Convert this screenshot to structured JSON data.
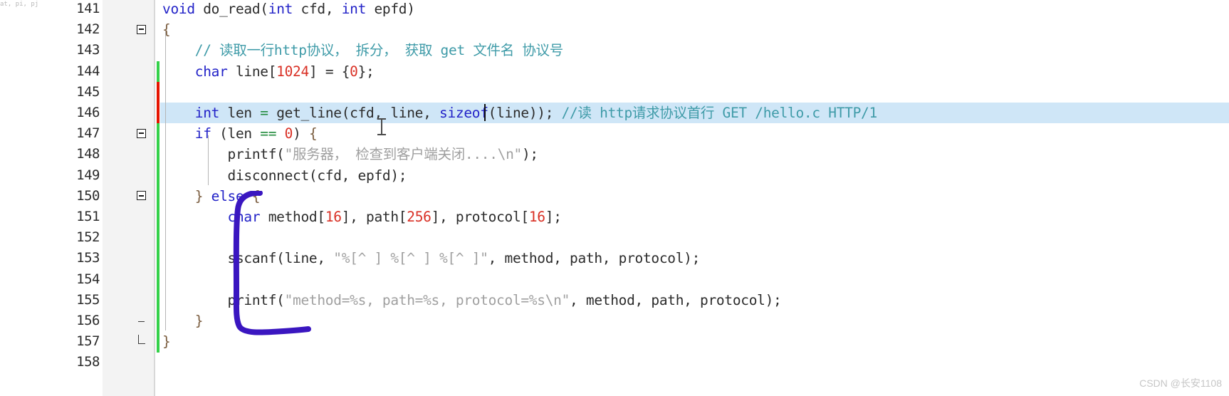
{
  "app": {
    "kind": "code-editor",
    "language": "C",
    "top_partial_text": "at, pi, pj"
  },
  "colors": {
    "keyword": "#2323c8",
    "comment": "#3f9ba8",
    "string": "#a0a0a0",
    "number": "#d93025",
    "operator": "#1f8a3b",
    "brace": "#7a5c3e",
    "current_line_highlight": "#cfe6f7",
    "gutter_background": "#f3f3f3",
    "change_bar_saved": "#34d14a",
    "change_bar_unsaved": "#e51400",
    "annotation_ink": "#3a16c0",
    "watermark": "#c6c6c6"
  },
  "gutter": {
    "first_line": 141,
    "last_line": 158
  },
  "editor": {
    "highlighted_line": 146,
    "caret_line": 146,
    "caret_column_text": "l|ine"
  },
  "lines": [
    {
      "number": "141",
      "fold": "none",
      "change": "none",
      "indent": 0,
      "tokens": [
        {
          "t": "void ",
          "c": "kw"
        },
        {
          "t": "do_read",
          "c": "plain"
        },
        {
          "t": "(",
          "c": "plain"
        },
        {
          "t": "int ",
          "c": "kw"
        },
        {
          "t": "cfd, ",
          "c": "plain"
        },
        {
          "t": "int ",
          "c": "kw"
        },
        {
          "t": "epfd)",
          "c": "plain"
        }
      ]
    },
    {
      "number": "142",
      "fold": "open",
      "change": "none",
      "indent": 0,
      "tokens": [
        {
          "t": "{",
          "c": "brace"
        }
      ]
    },
    {
      "number": "143",
      "fold": "none",
      "change": "none",
      "indent": 1,
      "tokens": [
        {
          "t": "    // 读取一行http协议， 拆分， 获取 get 文件名 协议号",
          "c": "cmt"
        }
      ]
    },
    {
      "number": "144",
      "fold": "none",
      "change": "green",
      "indent": 1,
      "tokens": [
        {
          "t": "    ",
          "c": "plain"
        },
        {
          "t": "char ",
          "c": "kw"
        },
        {
          "t": "line[",
          "c": "plain"
        },
        {
          "t": "1024",
          "c": "num"
        },
        {
          "t": "] = {",
          "c": "plain"
        },
        {
          "t": "0",
          "c": "num"
        },
        {
          "t": "};",
          "c": "plain"
        }
      ]
    },
    {
      "number": "145",
      "fold": "none",
      "change": "red",
      "indent": 1,
      "tokens": []
    },
    {
      "number": "146",
      "fold": "none",
      "change": "red",
      "indent": 1,
      "highlight": true,
      "tokens": [
        {
          "t": "    ",
          "c": "plain"
        },
        {
          "t": "int ",
          "c": "kw"
        },
        {
          "t": "len ",
          "c": "plain"
        },
        {
          "t": "= ",
          "c": "op"
        },
        {
          "t": "get_line(cfd, line, ",
          "c": "plain"
        },
        {
          "t": "sizeof",
          "c": "kw"
        },
        {
          "t": "(line)); ",
          "c": "plain"
        },
        {
          "t": "//读 http请求协议首行 GET /hello.c HTTP/1",
          "c": "cmt"
        }
      ]
    },
    {
      "number": "147",
      "fold": "open",
      "change": "green",
      "indent": 1,
      "tokens": [
        {
          "t": "    ",
          "c": "plain"
        },
        {
          "t": "if ",
          "c": "kw"
        },
        {
          "t": "(len ",
          "c": "plain"
        },
        {
          "t": "== ",
          "c": "op"
        },
        {
          "t": "0",
          "c": "num"
        },
        {
          "t": ") ",
          "c": "plain"
        },
        {
          "t": "{",
          "c": "brace"
        }
      ]
    },
    {
      "number": "148",
      "fold": "none",
      "change": "green",
      "indent": 2,
      "tokens": [
        {
          "t": "        printf(",
          "c": "plain"
        },
        {
          "t": "\"服务器， 检查到客户端关闭....\\n\"",
          "c": "str"
        },
        {
          "t": ");",
          "c": "plain"
        }
      ]
    },
    {
      "number": "149",
      "fold": "none",
      "change": "green",
      "indent": 2,
      "tokens": [
        {
          "t": "        disconnect(cfd, epfd);",
          "c": "plain"
        }
      ]
    },
    {
      "number": "150",
      "fold": "open",
      "change": "green",
      "indent": 1,
      "tokens": [
        {
          "t": "    ",
          "c": "plain"
        },
        {
          "t": "}",
          "c": "brace"
        },
        {
          "t": " else ",
          "c": "kw"
        },
        {
          "t": "{",
          "c": "brace"
        }
      ]
    },
    {
      "number": "151",
      "fold": "none",
      "change": "green",
      "indent": 2,
      "tokens": [
        {
          "t": "        ",
          "c": "plain"
        },
        {
          "t": "char ",
          "c": "kw"
        },
        {
          "t": "method[",
          "c": "plain"
        },
        {
          "t": "16",
          "c": "num"
        },
        {
          "t": "], path[",
          "c": "plain"
        },
        {
          "t": "256",
          "c": "num"
        },
        {
          "t": "], protocol[",
          "c": "plain"
        },
        {
          "t": "16",
          "c": "num"
        },
        {
          "t": "];",
          "c": "plain"
        }
      ]
    },
    {
      "number": "152",
      "fold": "none",
      "change": "green",
      "indent": 2,
      "tokens": []
    },
    {
      "number": "153",
      "fold": "none",
      "change": "green",
      "indent": 2,
      "tokens": [
        {
          "t": "        sscanf(line, ",
          "c": "plain"
        },
        {
          "t": "\"%[^ ] %[^ ] %[^ ]\"",
          "c": "str"
        },
        {
          "t": ", method, path, protocol);",
          "c": "plain"
        }
      ]
    },
    {
      "number": "154",
      "fold": "none",
      "change": "green",
      "indent": 2,
      "tokens": []
    },
    {
      "number": "155",
      "fold": "none",
      "change": "green",
      "indent": 2,
      "tokens": [
        {
          "t": "        printf(",
          "c": "plain"
        },
        {
          "t": "\"method=%s, path=%s, protocol=%s\\n\"",
          "c": "str"
        },
        {
          "t": ", method, path, protocol);",
          "c": "plain"
        }
      ]
    },
    {
      "number": "156",
      "fold": "end-tick",
      "change": "green",
      "indent": 1,
      "tokens": [
        {
          "t": "    ",
          "c": "plain"
        },
        {
          "t": "}",
          "c": "brace"
        }
      ]
    },
    {
      "number": "157",
      "fold": "end-corner",
      "change": "green",
      "indent": 0,
      "tokens": [
        {
          "t": "}",
          "c": "brace"
        }
      ]
    },
    {
      "number": "158",
      "fold": "none",
      "change": "none",
      "indent": 0,
      "tokens": []
    }
  ],
  "annotation": {
    "kind": "hand-drawn-bracket",
    "description": "purple hand drawn bracket around lines 151-156"
  },
  "watermark": {
    "text": "CSDN @长安1108"
  }
}
